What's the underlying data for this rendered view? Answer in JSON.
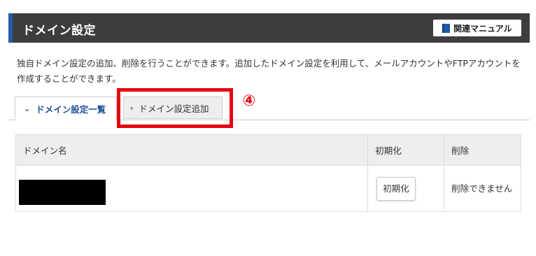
{
  "header": {
    "title": "ドメイン設定",
    "manual_button": "関連マニュアル",
    "manual_icon": "book-icon",
    "accent_color": "#2a5aa8"
  },
  "description": "独自ドメイン設定の追加、削除を行うことができます。追加したドメイン設定を利用して、メールアカウントやFTPアカウントを作成することができます。",
  "tabs": [
    {
      "label": "ドメイン設定一覧",
      "active": true,
      "icon": "chevron-down-icon"
    },
    {
      "label": "ドメイン設定追加",
      "active": false,
      "icon": "chevron-right-icon"
    }
  ],
  "annotation": {
    "step_number": "④",
    "color": "#e60012"
  },
  "table": {
    "columns": [
      "ドメイン名",
      "初期化",
      "削除"
    ],
    "rows": [
      {
        "domain": "",
        "init_button": "初期化",
        "delete_status": "削除できません"
      }
    ]
  }
}
